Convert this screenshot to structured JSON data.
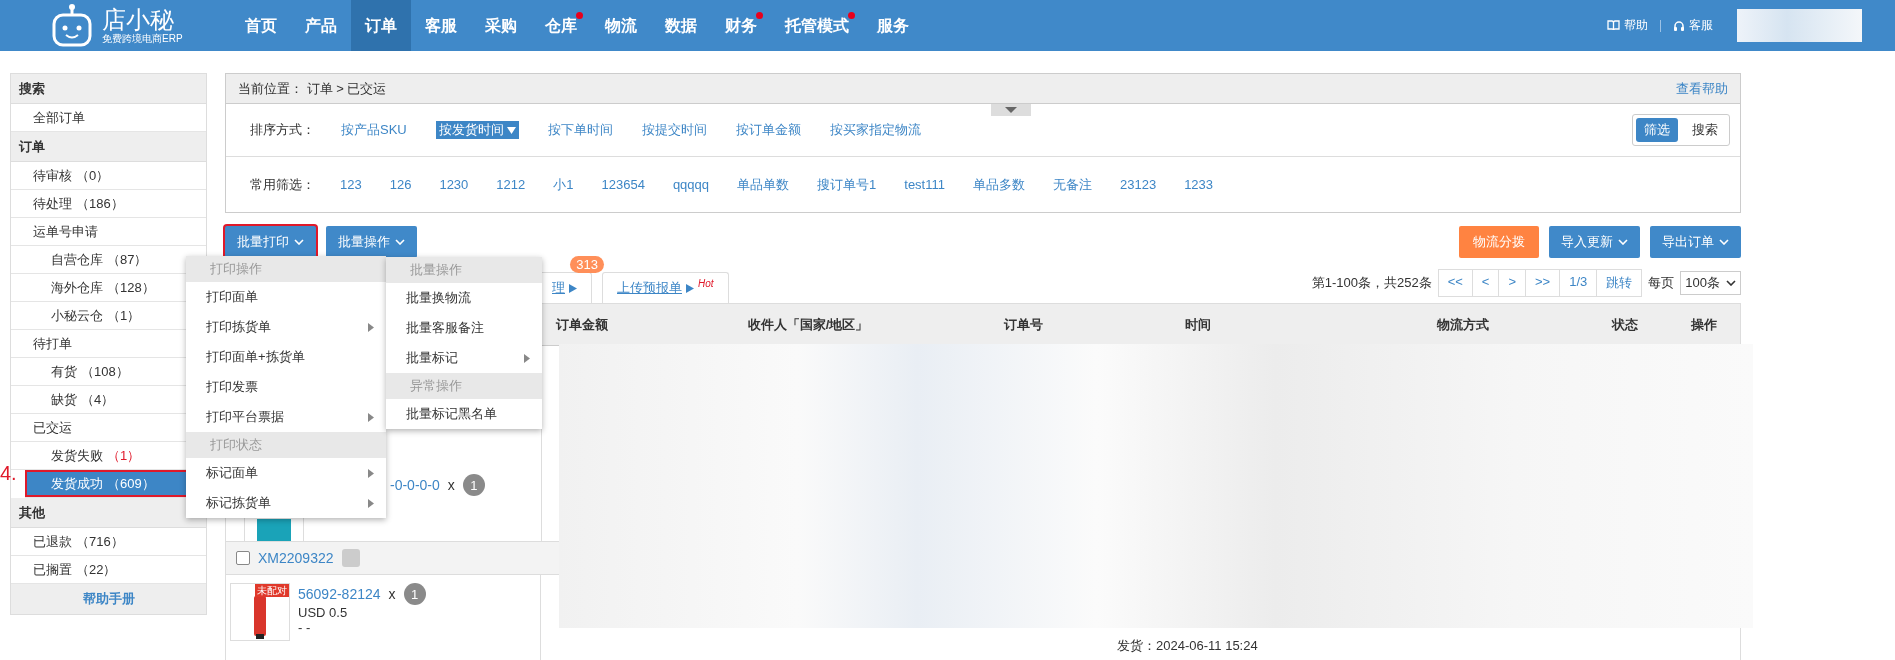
{
  "top_nav": {
    "logo_text": "店小秘",
    "logo_subtitle": "免费跨境电商ERP",
    "items": [
      {
        "label": "首页",
        "selected": false,
        "dot": false
      },
      {
        "label": "产品",
        "selected": false,
        "dot": false
      },
      {
        "label": "订单",
        "selected": true,
        "dot": false
      },
      {
        "label": "客服",
        "selected": false,
        "dot": false
      },
      {
        "label": "采购",
        "selected": false,
        "dot": false
      },
      {
        "label": "仓库",
        "selected": false,
        "dot": true
      },
      {
        "label": "物流",
        "selected": false,
        "dot": false
      },
      {
        "label": "数据",
        "selected": false,
        "dot": false
      },
      {
        "label": "财务",
        "selected": false,
        "dot": true
      },
      {
        "label": "托管模式",
        "selected": false,
        "dot": true
      },
      {
        "label": "服务",
        "selected": false,
        "dot": false
      }
    ],
    "help": "帮助",
    "service": "客服"
  },
  "sidebar": {
    "sections": [
      {
        "title": "搜索",
        "items": [
          {
            "label": "全部订单",
            "selected": false,
            "annotated": false
          }
        ]
      },
      {
        "title": "订单",
        "items": [
          {
            "label": "待审核",
            "count": "（0）",
            "alert": false,
            "selected": false,
            "annotated": false
          },
          {
            "label": "待处理",
            "count": "（186）",
            "alert": false,
            "selected": false,
            "annotated": false
          },
          {
            "label": "运单号申请",
            "selected": false,
            "annotated": false,
            "children": [
              {
                "label": "自营仓库",
                "count": "（87）",
                "alert": false,
                "selected": false,
                "annotated": false
              },
              {
                "label": "海外仓库",
                "count": "（128）",
                "alert": false,
                "selected": false,
                "annotated": false
              },
              {
                "label": "小秘云仓",
                "count": "（1）",
                "alert": false,
                "selected": false,
                "annotated": false
              }
            ]
          },
          {
            "label": "待打单",
            "selected": false,
            "annotated": false,
            "children": [
              {
                "label": "有货",
                "count": "（108）",
                "alert": false,
                "selected": false,
                "annotated": false
              },
              {
                "label": "缺货",
                "count": "（4）",
                "alert": false,
                "selected": false,
                "annotated": false
              }
            ]
          },
          {
            "label": "已交运",
            "selected": false,
            "annotated": false,
            "children": [
              {
                "label": "发货失败",
                "count": "（1）",
                "alert": true,
                "selected": false,
                "annotated": false
              },
              {
                "label": "发货成功",
                "count": "（609）",
                "alert": false,
                "selected": true,
                "annotated": true
              }
            ]
          }
        ]
      },
      {
        "title": "其他",
        "items": [
          {
            "label": "已退款",
            "count": "（716）",
            "alert": false,
            "selected": false,
            "annotated": false
          },
          {
            "label": "已搁置",
            "count": "（22）",
            "alert": false,
            "selected": false,
            "annotated": false
          }
        ]
      }
    ],
    "footer": "帮助手册"
  },
  "annotation_step": "4.",
  "breadcrumb": {
    "text": "当前位置：  订单 > 已交运",
    "help_link": "查看帮助"
  },
  "sort": {
    "label": "排序方式：",
    "options": [
      {
        "label": "按产品SKU",
        "selected": false
      },
      {
        "label": "按发货时间",
        "selected": true
      },
      {
        "label": "按下单时间",
        "selected": false
      },
      {
        "label": "按提交时间",
        "selected": false
      },
      {
        "label": "按订单金额",
        "selected": false
      },
      {
        "label": "按买家指定物流",
        "selected": false
      }
    ]
  },
  "view_toggle": [
    {
      "label": "筛选",
      "selected": true
    },
    {
      "label": "搜索",
      "selected": false
    }
  ],
  "filters": {
    "label": "常用筛选：",
    "items": [
      "123",
      "126",
      "1230",
      "1212",
      "小1",
      "123654",
      "qqqqq",
      "单品单数",
      "搜订单号1",
      "test111",
      "单品多数",
      "无备注",
      "23123",
      "1233"
    ]
  },
  "toolbar": {
    "left": [
      {
        "label": "批量打印",
        "kind": "primary",
        "dropdown": true,
        "annotated": true
      },
      {
        "label": "批量操作",
        "kind": "primary",
        "dropdown": true,
        "annotated": false
      }
    ],
    "right": [
      {
        "label": "物流分拨",
        "kind": "warning",
        "dropdown": false,
        "annotated": false
      },
      {
        "label": "导入更新",
        "kind": "primary",
        "dropdown": true,
        "annotated": false
      },
      {
        "label": "导出订单",
        "kind": "primary",
        "dropdown": true,
        "annotated": false
      }
    ]
  },
  "print_menu": [
    {
      "heading": "打印操作",
      "items": [
        {
          "label": "打印面单",
          "submenu": false
        },
        {
          "label": "打印拣货单",
          "submenu": true
        },
        {
          "label": "打印面单+拣货单",
          "submenu": false
        },
        {
          "label": "打印发票",
          "submenu": false
        },
        {
          "label": "打印平台票据",
          "submenu": true
        }
      ]
    },
    {
      "heading": "打印状态",
      "items": [
        {
          "label": "标记面单",
          "submenu": true
        },
        {
          "label": "标记拣货单",
          "submenu": true
        }
      ]
    }
  ],
  "batch_menu": [
    {
      "heading": "批量操作",
      "items": [
        {
          "label": "批量换物流",
          "submenu": false
        },
        {
          "label": "批量客服备注",
          "submenu": false
        },
        {
          "label": "批量标记",
          "submenu": true
        }
      ]
    },
    {
      "heading": "异常操作",
      "items": [
        {
          "label": "批量标记黑名单",
          "submenu": false
        }
      ]
    }
  ],
  "tabs": [
    {
      "label": "理",
      "badge": "313"
    },
    {
      "label": "上传预报单",
      "hot": "Hot"
    }
  ],
  "pagination": {
    "summary": "第1-100条，共252条",
    "buttons": [
      "<<",
      "<",
      ">",
      ">>",
      "1/3",
      "跳转"
    ],
    "per_page_label": "每页",
    "per_page": "100条"
  },
  "table": {
    "columns": [
      "订单金额",
      "收件人「国家/地区」",
      "订单号",
      "时间",
      "物流方式",
      "状态",
      "操作"
    ],
    "first_row": {
      "sku": "-0-0-0-0",
      "times": "x",
      "qty": "1"
    },
    "order": {
      "order_no": "XM2209322",
      "checked": false,
      "item": {
        "badge": "未配对",
        "sku": "56092-82124",
        "times": "x",
        "qty": "1",
        "price": "USD 0.5",
        "note": "- -"
      },
      "ship_time": "发货：2024-06-11 15:24"
    }
  }
}
